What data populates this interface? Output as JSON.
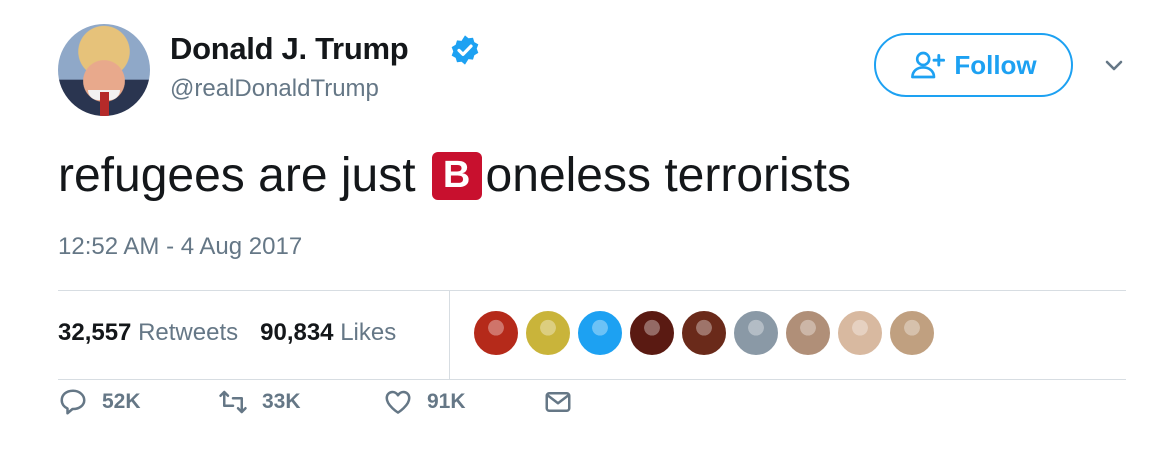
{
  "author": {
    "name": "Donald J. Trump",
    "handle": "@realDonaldTrump",
    "verified": true,
    "avatar_icon": "avatar-photo"
  },
  "follow_button": {
    "label": "Follow",
    "icon": "add-user-icon"
  },
  "tweet": {
    "text_before": "refugees are just",
    "emoji": {
      "glyph": "B",
      "name": "b-button-emoji",
      "color": "#c8102e"
    },
    "text_after": "oneless terrorists"
  },
  "timestamp": "12:52 AM - 4 Aug 2017",
  "stats": {
    "retweets_count": "32,557",
    "retweets_label": "Retweets",
    "likes_count": "90,834",
    "likes_label": "Likes"
  },
  "likers": [
    {
      "color": "#b52a1a"
    },
    {
      "color": "#c9b43a"
    },
    {
      "color": "#1da1f2"
    },
    {
      "color": "#5a1a12"
    },
    {
      "color": "#6a2a1a"
    },
    {
      "color": "#8a99a6"
    },
    {
      "color": "#b08f78"
    },
    {
      "color": "#d8b9a0"
    },
    {
      "color": "#c0a080"
    }
  ],
  "actions": {
    "reply_count": "52K",
    "retweet_count": "33K",
    "like_count": "91K"
  },
  "colors": {
    "accent": "#1da1f2",
    "muted": "#657786",
    "text": "#14171a"
  }
}
